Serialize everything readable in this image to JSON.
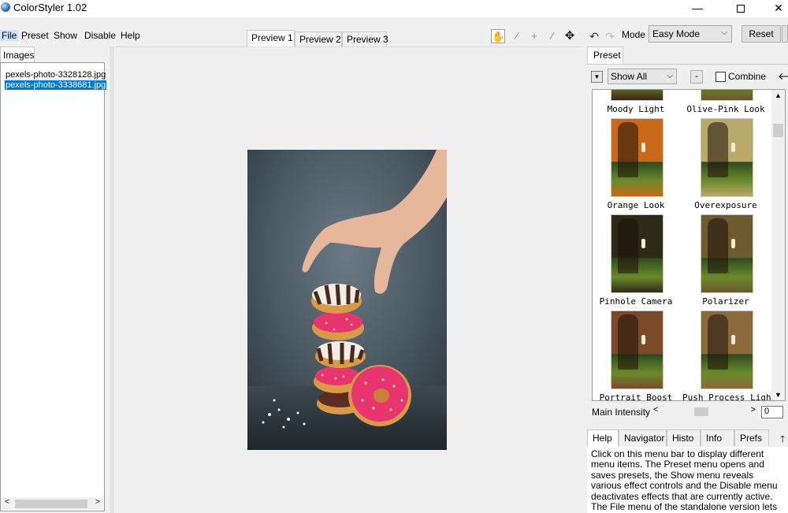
{
  "window": {
    "title": "ColorStyler 1.02",
    "minimize_glyph": "—",
    "close_glyph": "✕"
  },
  "menu": {
    "file": "File",
    "preset": "Preset",
    "show": "Show",
    "disable": "Disable",
    "help": "Help"
  },
  "preview_tabs": [
    "Preview 1",
    "Preview 2",
    "Preview 3"
  ],
  "toolbar": {
    "icons": [
      "hand-icon",
      "eyedropper-icon",
      "crosshair-icon",
      "brush-icon",
      "split-view-icon",
      "undo-icon",
      "redo-icon"
    ],
    "hand_glyph": "✋",
    "eyedropper_glyph": "⁄",
    "crosshair_glyph": "+",
    "brush_glyph": "⁄",
    "split_glyph": "✥",
    "undo_glyph": "↶",
    "redo_glyph": "↷",
    "mode_label": "Mode",
    "mode_value": "Easy Mode",
    "reset_label": "Reset"
  },
  "images_panel": {
    "tab_label": "Images",
    "files": [
      "pexels-photo-3328128.jpg",
      "pexels-photo-3338681.jpg"
    ],
    "selected_index": 1
  },
  "preset_panel": {
    "tab_label": "Preset",
    "filter_value": "Show All",
    "minus_label": "-",
    "combine_label": "Combine",
    "combine_checked": false,
    "back_glyph": "🡐",
    "presets": [
      {
        "name": "Moody Light",
        "tint": "#3a2418"
      },
      {
        "name": "Olive-Pink Look",
        "tint": "#6b5a30"
      },
      {
        "name": "Orange Look",
        "tint": "#c86a1a"
      },
      {
        "name": "Overexposure",
        "tint": "#b9a96a"
      },
      {
        "name": "Pinhole Camera",
        "tint": "#2e2a18"
      },
      {
        "name": "Polarizer",
        "tint": "#6d5a2e"
      },
      {
        "name": "Portrait Boost",
        "tint": "#7a4a2a"
      },
      {
        "name": "Push Process Light",
        "tint": "#8a6a3a"
      }
    ],
    "intensity_label": "Main Intensity",
    "intensity_value": "0"
  },
  "info_panel": {
    "tabs": [
      "Help",
      "Navigator",
      "Histo",
      "Info",
      "Prefs"
    ],
    "active_tab": "Help",
    "help_text": "Click on this menu bar to display different menu items. The Preset menu opens and saves presets, the Show menu reveals various effect controls and the Disable menu deactivates effects that are currently active. The File menu of the standalone version lets you open and save image files among"
  },
  "colors": {
    "selection": "#0078d7",
    "menu_highlight": "#cce4f7",
    "donut_pink": "#e8356f",
    "donut_dough": "#d99a45",
    "backdrop": "#4a5a66"
  }
}
